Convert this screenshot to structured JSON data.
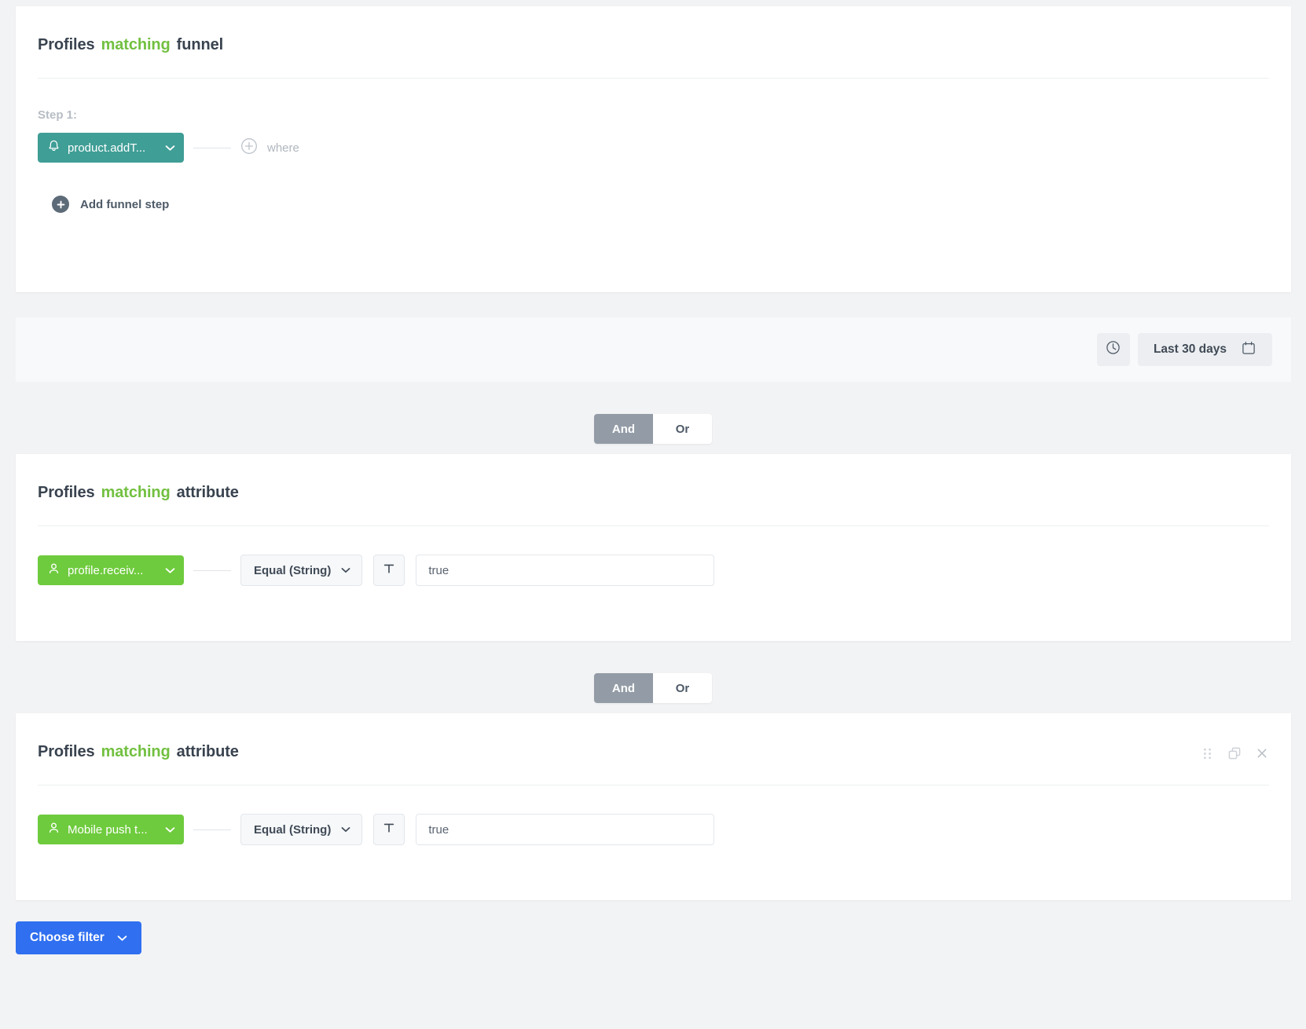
{
  "funnel_card": {
    "title_words": [
      "Profiles",
      "matching",
      "funnel"
    ],
    "step_label": "Step 1:",
    "event_pill": "product.addT...",
    "where_label": "where",
    "add_step_label": "Add funnel step"
  },
  "date_bar": {
    "clock_icon": "clock-icon",
    "range_label": "Last 30 days",
    "calendar_icon": "calendar-icon"
  },
  "toggle_1": {
    "and_label": "And",
    "or_label": "Or",
    "active": "And"
  },
  "attribute_card_1": {
    "title_words": [
      "Profiles",
      "matching",
      "attribute"
    ],
    "attribute_pill": "profile.receiv...",
    "operator": "Equal (String)",
    "type_glyph": "T",
    "value": "true",
    "value_placeholder": "true"
  },
  "toggle_2": {
    "and_label": "And",
    "or_label": "Or",
    "active": "And"
  },
  "attribute_card_2": {
    "title_words": [
      "Profiles",
      "matching",
      "attribute"
    ],
    "attribute_pill": "Mobile push t...",
    "operator": "Equal (String)",
    "type_glyph": "T",
    "value": "true",
    "value_placeholder": "true",
    "actions": [
      "drag-handle-icon",
      "duplicate-icon",
      "close-icon"
    ]
  },
  "footer": {
    "choose_filter_label": "Choose filter"
  },
  "colors": {
    "page_bg": "#f2f3f5",
    "card_bg": "#ffffff",
    "keyword_green": "#72c040",
    "event_pill": "#3f9e96",
    "attribute_pill": "#6ecb3d",
    "primary_blue": "#2f6ff0",
    "toggle_active": "#939ca6",
    "muted_text": "#b7bdc4"
  }
}
